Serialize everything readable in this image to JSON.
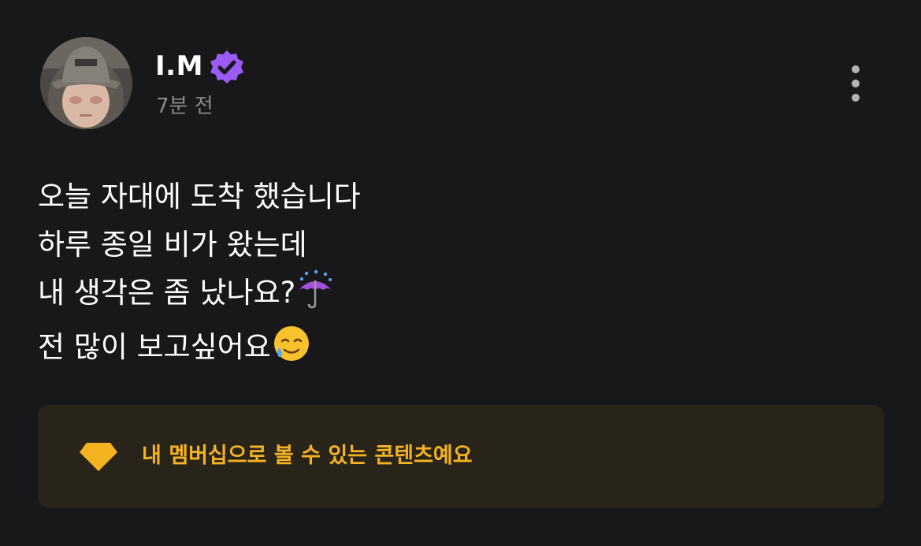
{
  "post": {
    "author": "I.M",
    "timestamp": "7분 전",
    "verified": true,
    "body_lines": [
      "오늘 자대에 도착 했습니다",
      "하루 종일 비가 왔는데",
      "내 생각은 좀 났나요?",
      "전 많이 보고싶어요"
    ],
    "line_emojis": {
      "line3": "umbrella-with-rain-icon",
      "line4": "smiling-face-with-tear-icon"
    }
  },
  "membership_notice": {
    "label": "내 멤버십으로 볼 수 있는 콘텐츠예요",
    "icon": "gem-icon"
  },
  "colors": {
    "background": "#18181a",
    "verified_badge": "#9b5cf6",
    "accent": "#f5b321",
    "notice_background": "#29241a",
    "timestamp": "#8a8a8e"
  }
}
